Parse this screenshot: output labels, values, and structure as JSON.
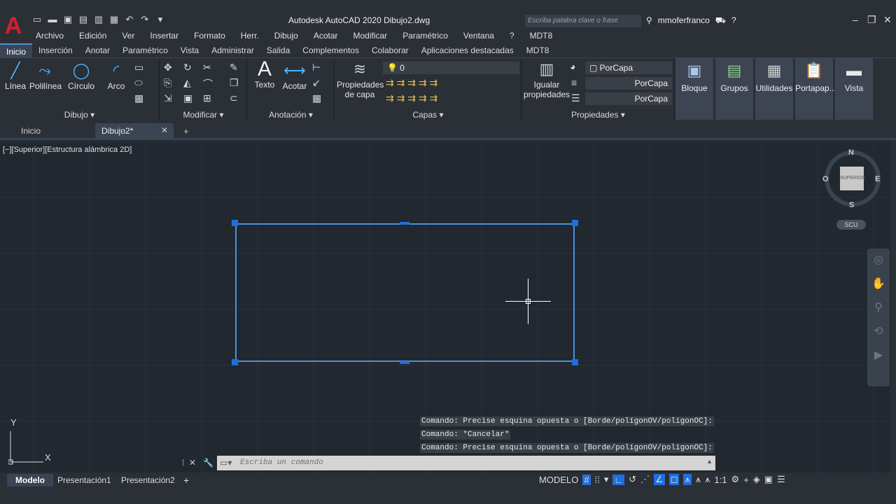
{
  "app": {
    "logo": "A",
    "title": "Autodesk AutoCAD 2020    Dibujo2.dwg",
    "search_placeholder": "Escriba palabra clave o frase",
    "user": "mmoferfranco"
  },
  "qat_icons": [
    "new-icon",
    "open-icon",
    "save-icon",
    "saveas-icon",
    "plot-preview-icon",
    "print-icon",
    "undo-icon",
    "redo-icon",
    "more-icon"
  ],
  "menubar": [
    "Archivo",
    "Edición",
    "Ver",
    "Insertar",
    "Formato",
    "Herr.",
    "Dibujo",
    "Acotar",
    "Modificar",
    "Paramétrico",
    "Ventana",
    "?",
    "MDT8"
  ],
  "ribbon_tabs": [
    "Inicio",
    "Inserción",
    "Anotar",
    "Paramétrico",
    "Vista",
    "Administrar",
    "Salida",
    "Complementos",
    "Colaborar",
    "Aplicaciones destacadas",
    "MDT8"
  ],
  "ribbon": {
    "draw": {
      "title": "Dibujo ▾",
      "tools": [
        "Línea",
        "Polilínea",
        "Círculo",
        "Arco"
      ]
    },
    "modify": {
      "title": "Modificar ▾"
    },
    "annotation": {
      "title": "Anotación ▾",
      "text": "Texto",
      "dim": "Acotar"
    },
    "layers": {
      "title": "Capas ▾",
      "props": "Propiedades de capa",
      "current": "0"
    },
    "properties": {
      "title": "Propiedades ▾",
      "match": "Igualar propiedades",
      "color": "PorCapa",
      "linetype": "PorCapa",
      "lineweight": "PorCapa"
    },
    "big": [
      "Bloque",
      "Grupos",
      "Utilidades",
      "Portapap...",
      "Vista"
    ]
  },
  "doc_tabs": {
    "home": "Inicio",
    "active": "Dibujo2*"
  },
  "viewport_label": "[−][Superior][Estructura alámbrica 2D]",
  "viewcube": {
    "n": "N",
    "s": "S",
    "e": "E",
    "o": "O",
    "face": "SUPERIOR",
    "ucs": "SCU"
  },
  "command_history": [
    "Comando: Precise esquina opuesta o [Borde/polígonOV/polígonOC]:",
    "Comando: *Cancelar*",
    "Comando: Precise esquina opuesta o [Borde/polígonOV/polígonOC]:"
  ],
  "command_placeholder": "Escriba un comando",
  "layout_tabs": [
    "Modelo",
    "Presentación1",
    "Presentación2"
  ],
  "status": {
    "space": "MODELO",
    "scale": "1:1"
  },
  "colors": {
    "accent": "#4a90e2",
    "grip": "#1e6fe0",
    "logo": "#d4202a"
  }
}
